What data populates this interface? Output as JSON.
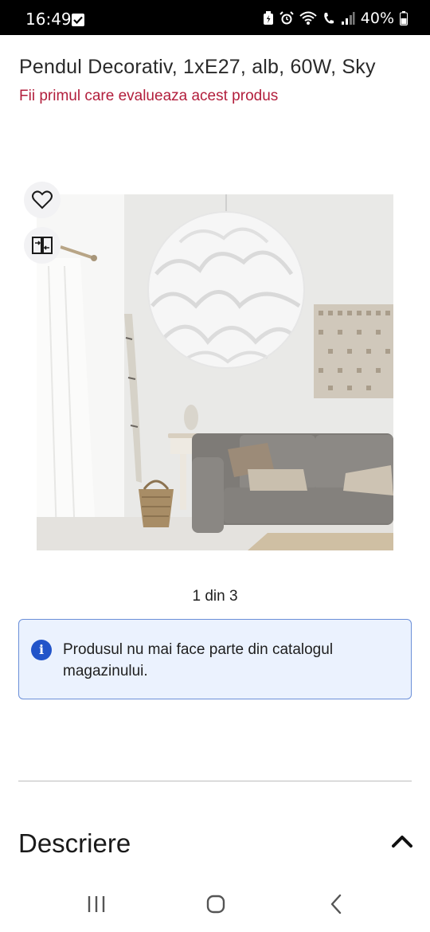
{
  "status_bar": {
    "time": "16:49",
    "battery": "40%"
  },
  "product": {
    "title": "Pendul Decorativ, 1xE27, alb, 60W, Sky",
    "rating_link": "Fii primul care evalueaza acest produs",
    "image_description_icon": "product-photo",
    "pager": "1 din 3"
  },
  "notice": {
    "text": "Produsul nu mai face parte din catalogul magazinului."
  },
  "description": {
    "title": "Descriere"
  },
  "colors": {
    "accent_red": "#b21e3c",
    "info_blue": "#2254c9",
    "info_bg": "#ebf2fe"
  }
}
